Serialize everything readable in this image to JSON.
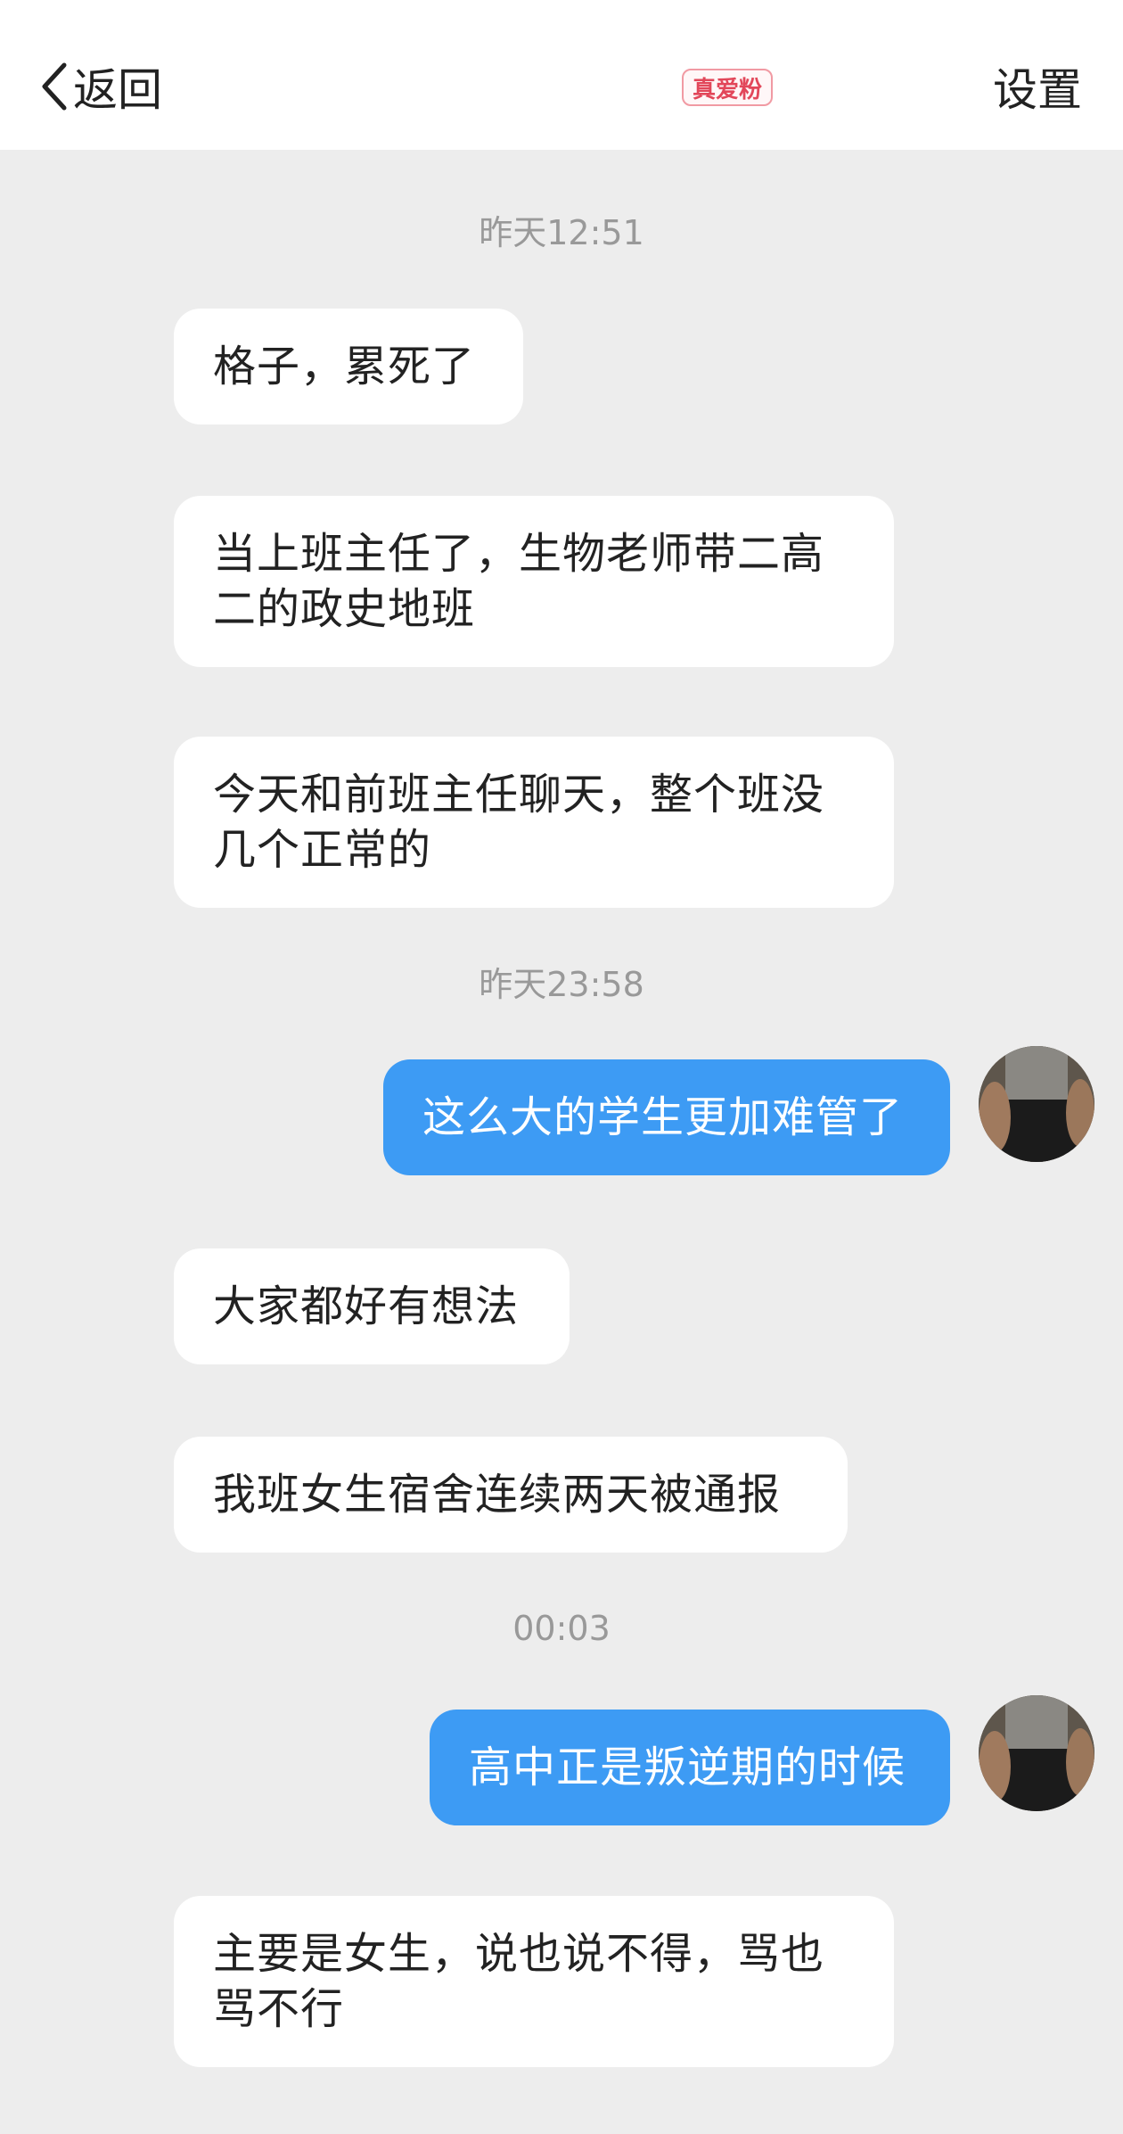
{
  "header": {
    "back_label": "返回",
    "badge_label": "真爱粉",
    "settings_label": "设置"
  },
  "messages": [
    {
      "type": "time",
      "text": "昨天12:51"
    },
    {
      "type": "in",
      "text": "格子，累死了"
    },
    {
      "type": "in",
      "lines": [
        "当上班主任了，生物老师带二高",
        "二的政史地班"
      ]
    },
    {
      "type": "in",
      "lines": [
        "今天和前班主任聊天，整个班没",
        "几个正常的"
      ]
    },
    {
      "type": "time",
      "text": "昨天23:58"
    },
    {
      "type": "out",
      "text": "这么大的学生更加难管了"
    },
    {
      "type": "in",
      "text": "大家都好有想法"
    },
    {
      "type": "in",
      "text": "我班女生宿舍连续两天被通报"
    },
    {
      "type": "time",
      "text": "00:03"
    },
    {
      "type": "out",
      "text": "高中正是叛逆期的时候"
    },
    {
      "type": "in",
      "lines": [
        "主要是女生，说也说不得，骂也",
        "骂不行"
      ]
    }
  ],
  "colors": {
    "background": "#ededed",
    "outgoing_bubble": "#3d9bf4",
    "incoming_bubble": "#ffffff",
    "badge": "#e2475a"
  }
}
